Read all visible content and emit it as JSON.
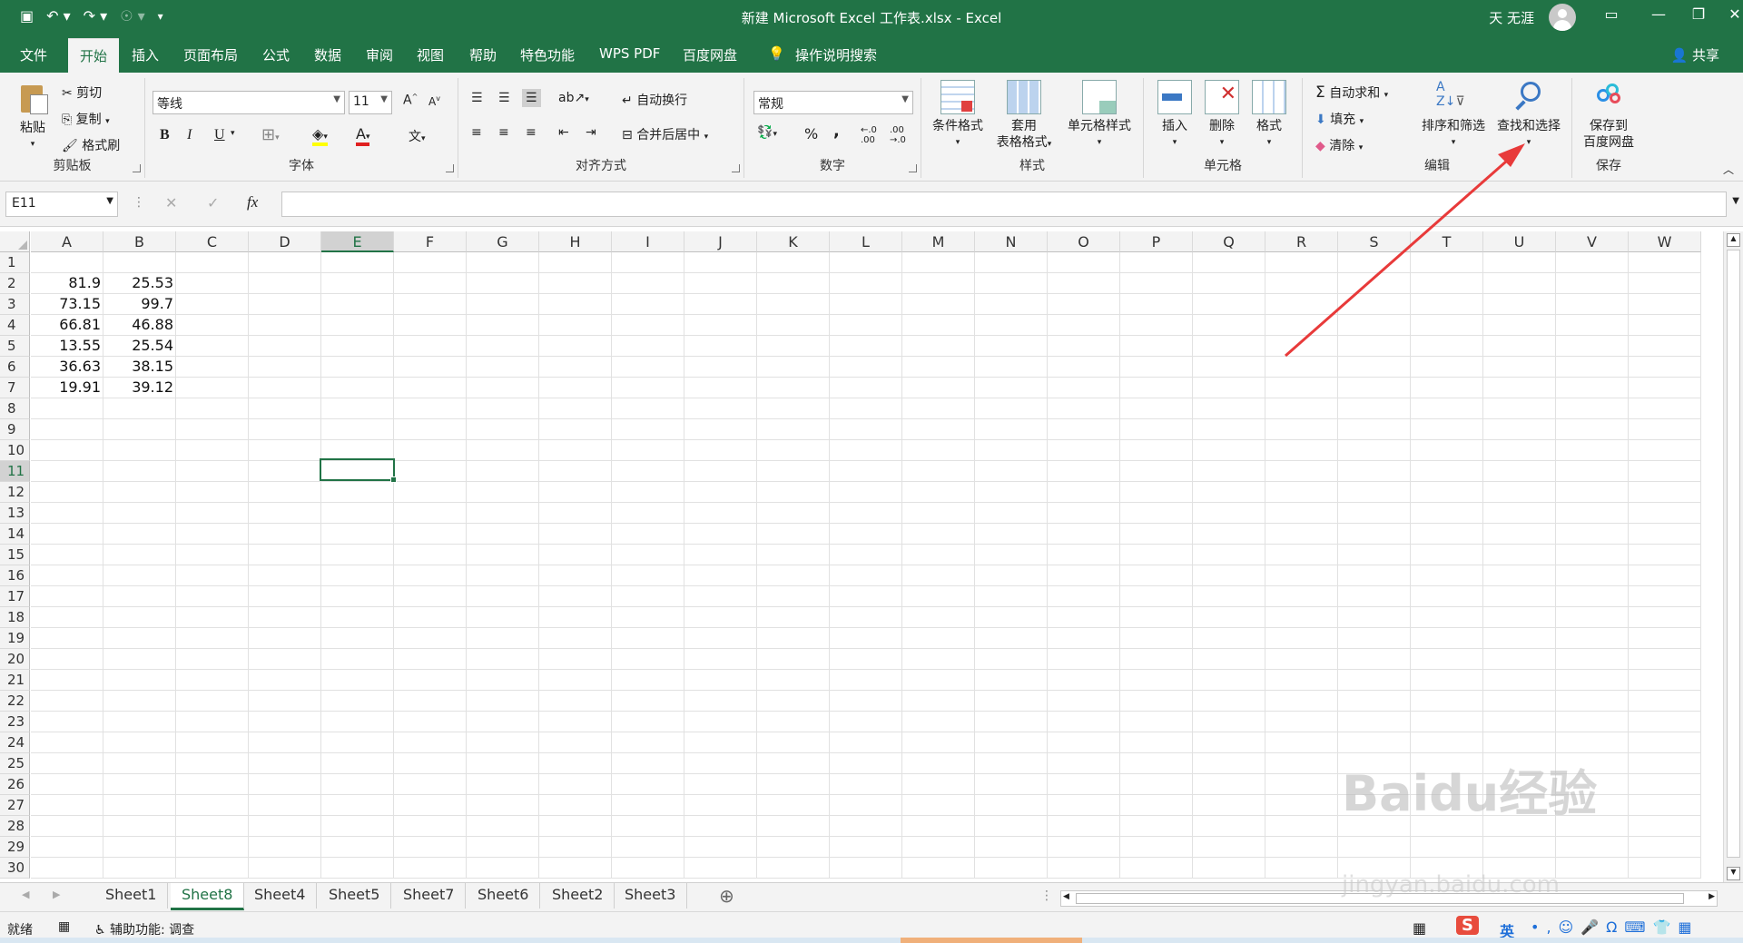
{
  "window": {
    "title": "新建 Microsoft Excel 工作表.xlsx  -  Excel",
    "user": "天 无涯",
    "share": "共享"
  },
  "tabs": [
    "文件",
    "开始",
    "插入",
    "页面布局",
    "公式",
    "数据",
    "审阅",
    "视图",
    "帮助",
    "特色功能",
    "WPS PDF",
    "百度网盘"
  ],
  "tell_me": "操作说明搜索",
  "clipboard": {
    "paste": "粘贴",
    "cut": "剪切",
    "copy": "复制",
    "format_painter": "格式刷",
    "label": "剪贴板"
  },
  "font": {
    "name": "等线",
    "size": "11",
    "label": "字体",
    "bold": "B",
    "italic": "I",
    "underline": "U"
  },
  "alignment": {
    "wrap": "自动换行",
    "merge": "合并后居中",
    "label": "对齐方式"
  },
  "number": {
    "format": "常规",
    "label": "数字",
    "percent": "%",
    "comma": ","
  },
  "styles": {
    "conditional": "条件格式",
    "table1": "套用",
    "table2": "表格格式",
    "cell_styles": "单元格样式",
    "label": "样式"
  },
  "cells": {
    "insert": "插入",
    "delete": "删除",
    "format": "格式",
    "label": "单元格"
  },
  "editing": {
    "autosum": "自动求和",
    "fill": "填充",
    "clear": "清除",
    "sort": "排序和筛选",
    "find": "查找和选择",
    "label": "编辑"
  },
  "save_group": {
    "line1": "保存到",
    "line2": "百度网盘",
    "label": "保存"
  },
  "formula_bar": {
    "name_box": "E11",
    "fx": "fx",
    "value": ""
  },
  "columns": [
    "A",
    "B",
    "C",
    "D",
    "E",
    "F",
    "G",
    "H",
    "I",
    "J",
    "K",
    "L",
    "M",
    "N",
    "O",
    "P",
    "Q",
    "R",
    "S",
    "T",
    "U",
    "V",
    "W"
  ],
  "rows": [
    "1",
    "2",
    "3",
    "4",
    "5",
    "6",
    "7",
    "8",
    "9",
    "10",
    "11",
    "12",
    "13",
    "14",
    "15",
    "16",
    "17",
    "18",
    "19",
    "20",
    "21",
    "22",
    "23",
    "24",
    "25",
    "26",
    "27",
    "28",
    "29",
    "30"
  ],
  "cell_data": [
    {
      "row": 2,
      "a": "81.9",
      "b": "25.53"
    },
    {
      "row": 3,
      "a": "73.15",
      "b": "99.7"
    },
    {
      "row": 4,
      "a": "66.81",
      "b": "46.88"
    },
    {
      "row": 5,
      "a": "13.55",
      "b": "25.54"
    },
    {
      "row": 6,
      "a": "36.63",
      "b": "38.15"
    },
    {
      "row": 7,
      "a": "19.91",
      "b": "39.12"
    }
  ],
  "active_cell": {
    "column": "E",
    "row": 11
  },
  "sheets": [
    "Sheet1",
    "Sheet8",
    "Sheet4",
    "Sheet5",
    "Sheet7",
    "Sheet6",
    "Sheet2",
    "Sheet3"
  ],
  "active_sheet": "Sheet8",
  "status": {
    "ready": "就绪",
    "accessibility": "辅助功能: 调查",
    "ime": "英"
  },
  "watermark": {
    "main": "Baidu经验",
    "sub": "jingyan.baidu.com"
  },
  "colors": {
    "accent": "#217346",
    "arrow": "#e83a3a"
  }
}
